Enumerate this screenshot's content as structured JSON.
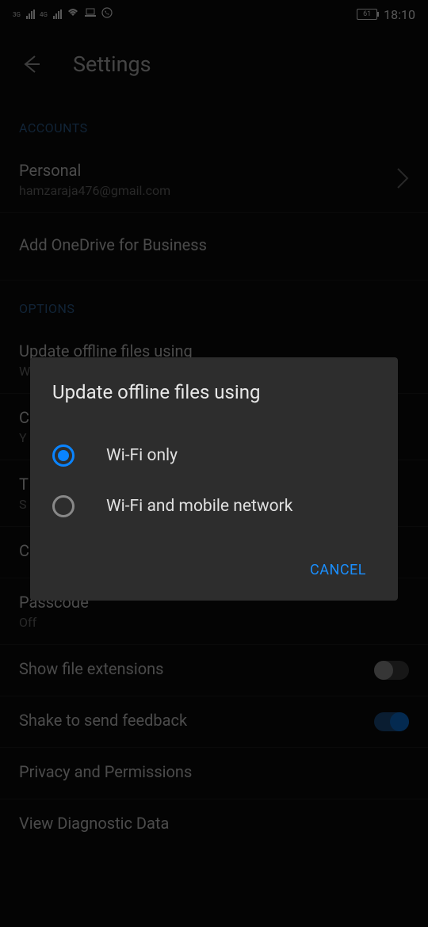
{
  "statusBar": {
    "signal1Label": "3G",
    "signal2Label": "4G",
    "batteryLevel": "61",
    "time": "18:10"
  },
  "appBar": {
    "title": "Settings"
  },
  "sections": {
    "accounts": {
      "header": "ACCOUNTS",
      "personal": {
        "title": "Personal",
        "subtitle": "hamzaraja476@gmail.com"
      },
      "addBusiness": {
        "title": "Add OneDrive for Business"
      }
    },
    "options": {
      "header": "OPTIONS",
      "updateOffline": {
        "title": "Update offline files using",
        "subtitle": "W"
      },
      "item2": {
        "title": "C",
        "subtitle": "Y"
      },
      "item3": {
        "title": "T",
        "subtitle": "S"
      },
      "item4": {
        "title": "C"
      },
      "passcode": {
        "title": "Passcode",
        "subtitle": "Off"
      },
      "showExtensions": {
        "title": "Show file extensions"
      },
      "shakeFeedback": {
        "title": "Shake to send feedback"
      },
      "privacy": {
        "title": "Privacy and Permissions"
      },
      "diagnostic": {
        "title": "View Diagnostic Data"
      }
    }
  },
  "dialog": {
    "title": "Update offline files using",
    "option1": "Wi-Fi only",
    "option2": "Wi-Fi and mobile network",
    "cancel": "CANCEL"
  }
}
